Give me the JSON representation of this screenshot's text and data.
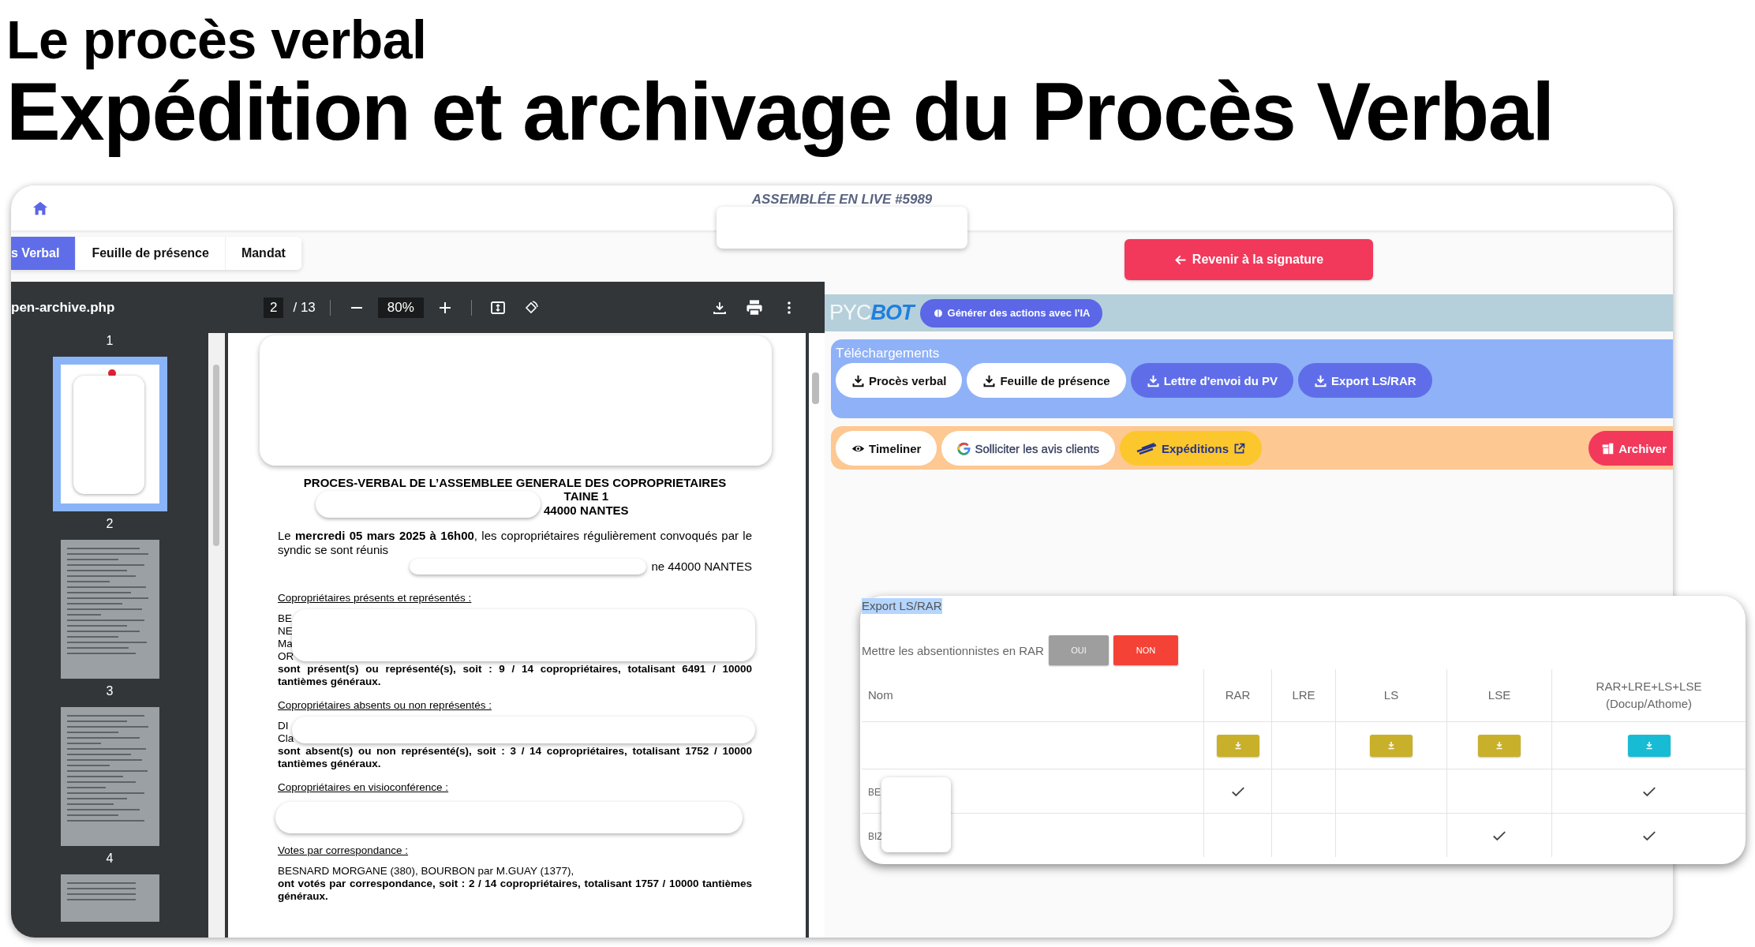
{
  "slide": {
    "subtitle": "Le procès verbal",
    "title": "Expédition et archivage du Procès Verbal"
  },
  "app": {
    "header_title": "ASSEMBLÉE EN LIVE #5989"
  },
  "tabs": [
    {
      "label": "s Verbal",
      "selected": true
    },
    {
      "label": "Feuille de présence",
      "selected": false
    },
    {
      "label": "Mandat",
      "selected": false
    }
  ],
  "viewer": {
    "filename": "pen-archive.php",
    "page": "2",
    "page_count": "/ 13",
    "zoom": "80%",
    "top_label": "1",
    "thumbnails": [
      {
        "number": "2",
        "selected": true
      },
      {
        "number": "3",
        "selected": false
      },
      {
        "number": "4",
        "selected": false
      }
    ],
    "document": {
      "title": "PROCES-VERBAL DE L’ASSEMBLEE GENERALE DES COPROPRIETAIRES",
      "title_line_2": "TAINE 1",
      "title_line_3": "44000 NANTES",
      "intro": "Le **mercredi 05 mars 2025 à 16h00**, les copropriétaires régulièrement convoqués par le syndic se sont réunis",
      "intro_tail": "ne 44000 NANTES",
      "sections": [
        {
          "heading": "Copropriétaires présents et représentés :",
          "names": [
            "BE",
            "NE",
            "Ma",
            "OR"
          ],
          "redacted": true,
          "summary": "sont présent(s) ou représenté(s), soit : 9 / 14 copropriétaires, totalisant 6491 / 10000 tantièmes généraux."
        },
        {
          "heading": "Copropriétaires absents ou non représentés :",
          "names": [
            "DI",
            "Cla"
          ],
          "redacted": true,
          "summary": "sont absent(s) ou non représenté(s), soit : 3 / 14 copropriétaires, totalisant 1752 / 10000 tantièmes généraux."
        },
        {
          "heading": "Copropriétaires en visioconférence :",
          "redacted": true
        },
        {
          "heading": "Votes par correspondance :",
          "names": [
            "BESNARD MORGANE (380), BOURBON par M.GUAY (1377),"
          ],
          "redacted": false,
          "summary": "ont votés par correspondance, soit : 2 / 14 copropriétaires, totalisant 1757 / 10000 tantièmes généraux."
        }
      ]
    }
  },
  "panel": {
    "return_button": "Revenir à la signature",
    "logo": "PYC**BOT**",
    "ai_button": "Générer des actions avec l'IA",
    "downloads": {
      "title": "Téléchargements",
      "buttons": [
        {
          "label": "Procès verbal",
          "kind": "light"
        },
        {
          "label": "Feuille de présence",
          "kind": "light"
        },
        {
          "label": "Lettre d'envoi du PV",
          "kind": "primary"
        },
        {
          "label": "Export LS/RAR",
          "kind": "primary"
        }
      ]
    },
    "actions": [
      {
        "label": "Timeliner",
        "kind": "eye"
      },
      {
        "label": "Solliciter les avis clients",
        "kind": "google"
      },
      {
        "label": "Expéditions",
        "kind": "shipping"
      },
      {
        "label": "Archiver",
        "kind": "archive"
      }
    ]
  },
  "export": {
    "title": "Export LS/RAR",
    "toggle_label": "Mettre les absentionnistes en RAR",
    "options": [
      {
        "label": "OUI",
        "selected": false
      },
      {
        "label": "NON",
        "selected": true
      }
    ],
    "columns": [
      "Nom",
      "RAR",
      "LRE",
      "LS",
      "LSE",
      "RAR+LRE+LS+LSE (Docup/Athome)"
    ],
    "download_row": [
      {
        "kind": "standard"
      },
      {
        "kind": "none"
      },
      {
        "kind": "standard"
      },
      {
        "kind": "standard"
      },
      {
        "kind": "combined"
      }
    ],
    "rows": [
      {
        "name": "BE",
        "checks": [
          true,
          false,
          false,
          false,
          true
        ]
      },
      {
        "name": "BIZ",
        "checks": [
          false,
          false,
          false,
          true,
          true
        ]
      }
    ]
  }
}
